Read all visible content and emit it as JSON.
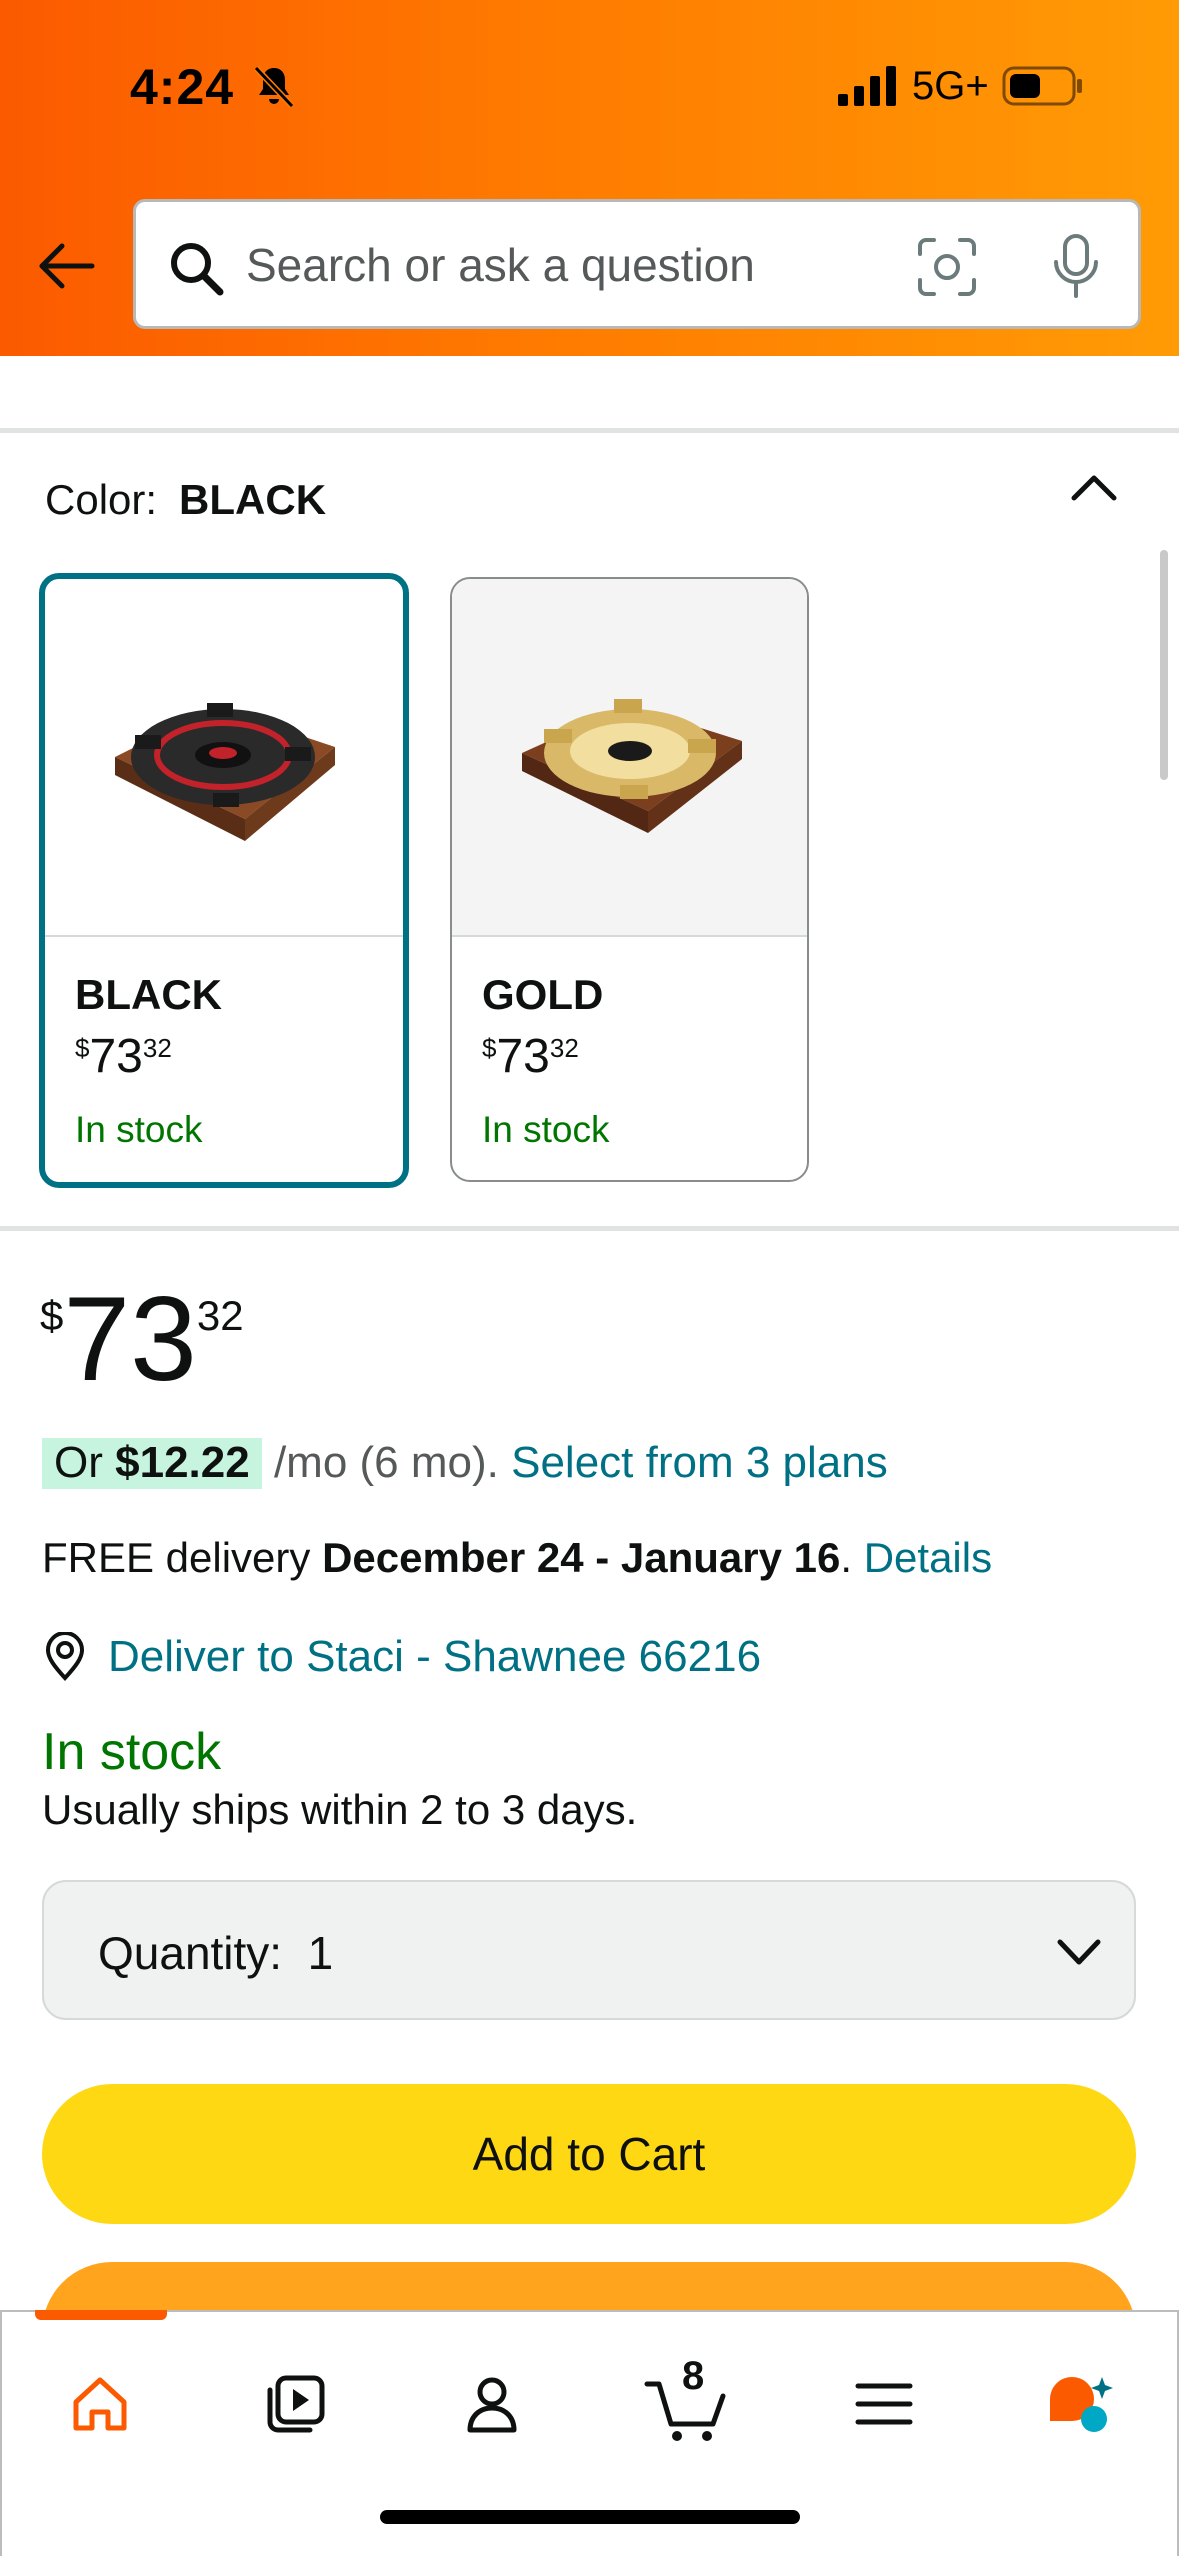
{
  "status_bar": {
    "time": "4:24",
    "network": "5G+"
  },
  "search": {
    "placeholder": "Search or ask a question"
  },
  "color_selector": {
    "label": "Color:",
    "selected": "BLACK",
    "options": [
      {
        "name": "BLACK",
        "price_symbol": "$",
        "price_whole": "73",
        "price_fraction": "32",
        "availability": "In stock"
      },
      {
        "name": "GOLD",
        "price_symbol": "$",
        "price_whole": "73",
        "price_fraction": "32",
        "availability": "In stock"
      }
    ]
  },
  "price": {
    "symbol": "$",
    "whole": "73",
    "fraction": "32"
  },
  "financing": {
    "prefix": "Or",
    "monthly": "$12.22",
    "suffix": "/mo (6 mo).",
    "link": "Select from 3 plans"
  },
  "delivery": {
    "prefix": "FREE delivery",
    "dates": "December 24 - January 16",
    "period": ".",
    "link": "Details"
  },
  "deliver_to": "Deliver to Staci - Shawnee 66216",
  "availability": "In stock",
  "ships_note": "Usually ships within 2 to 3 days.",
  "quantity": {
    "label": "Quantity:",
    "value": "1"
  },
  "buttons": {
    "add_to_cart": "Add to Cart"
  },
  "bottom_nav": {
    "cart_count": "8",
    "active": "home"
  },
  "colors": {
    "accent_orange": "#fb5a00",
    "link_teal": "#007185",
    "stock_green": "#007600",
    "cart_yellow": "#ffd814",
    "buy_orange": "#ffa41c"
  }
}
